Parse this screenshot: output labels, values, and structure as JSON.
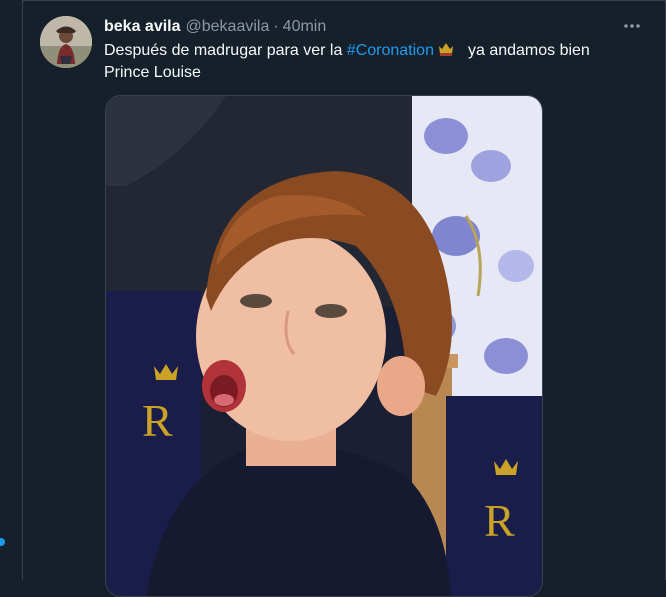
{
  "tweet": {
    "display_name": "beka avila",
    "handle": "@bekaavila",
    "separator": "·",
    "time": "40min",
    "text_before": "Después de madrugar para ver la ",
    "hashtag": "#Coronation",
    "text_after": "ya andamos bien",
    "text_line2": "Prince Louise",
    "more_icon": "more-icon",
    "emoji": "crown-emoji"
  },
  "media": {
    "description_icon": "photo"
  },
  "colors": {
    "background": "#15202b",
    "accent": "#1d9bf0",
    "secondary_text": "#8b98a5",
    "border": "#38444d"
  }
}
